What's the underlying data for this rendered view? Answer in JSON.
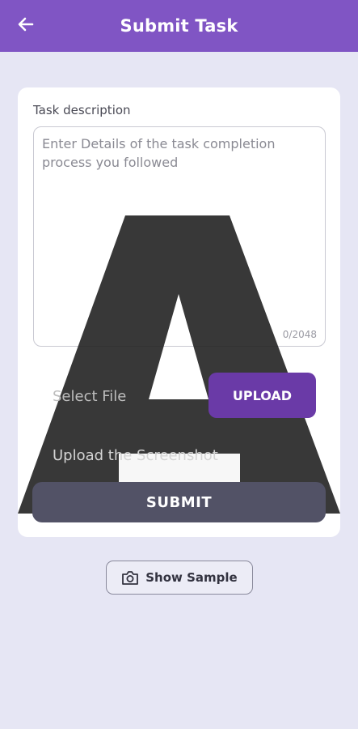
{
  "header": {
    "title": "Submit Task",
    "back_icon": "arrow-left-icon"
  },
  "form": {
    "description_label": "Task description",
    "description_placeholder": "Enter Details of the task completion process you followed",
    "description_value": "",
    "char_counter": "0/2048",
    "select_file_label": "Select File",
    "upload_label": "UPLOAD",
    "upload_hint": "Upload the Screenshot",
    "submit_label": "SUBMIT"
  },
  "sample": {
    "label": "Show Sample",
    "icon": "camera-icon"
  },
  "colors": {
    "app_bar": "#8055c4",
    "upload_button": "#6a3aa7",
    "submit_button": "#525266",
    "background": "#e6e6f4",
    "overlay_letter": "#1c1c1c"
  }
}
